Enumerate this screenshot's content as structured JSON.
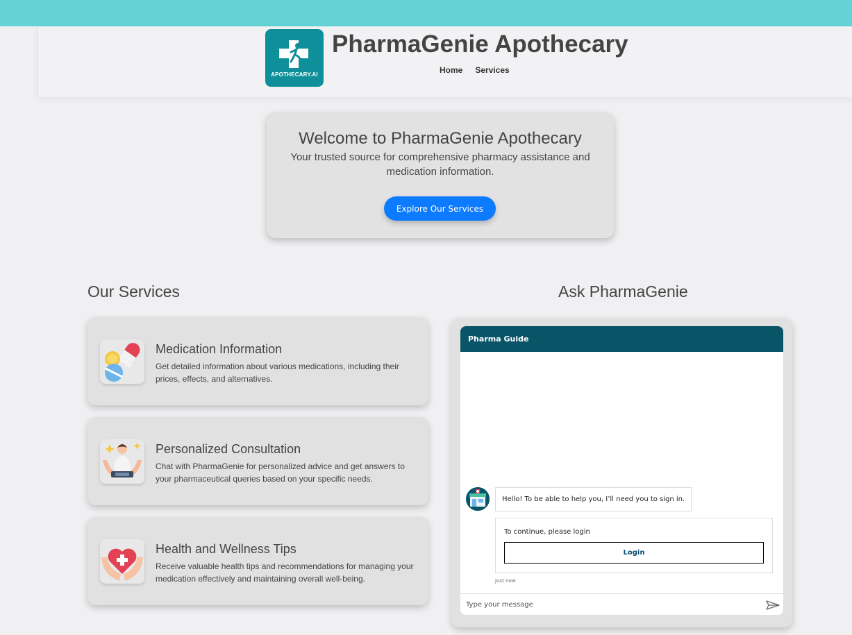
{
  "header": {
    "logo_text": "APOTHECARY.AI",
    "site_title": "PharmaGenie Apothecary",
    "nav": {
      "home": "Home",
      "services": "Services"
    }
  },
  "hero": {
    "title": "Welcome to PharmaGenie Apothecary",
    "subtitle": "Your trusted source for comprehensive pharmacy assistance and medication information.",
    "cta_label": "Explore Our Services"
  },
  "services": {
    "heading": "Our Services",
    "items": [
      {
        "icon": "pills-icon",
        "title": "Medication Information",
        "description": "Get detailed information about various medications, including their prices, effects, and alternatives."
      },
      {
        "icon": "pharmacist-icon",
        "title": "Personalized Consultation",
        "description": "Chat with PharmaGenie for personalized advice and get answers to your pharmaceutical queries based on your specific needs."
      },
      {
        "icon": "heart-hands-icon",
        "title": "Health and Wellness Tips",
        "description": "Receive valuable health tips and recommendations for managing your medication effectively and maintaining overall well-being."
      }
    ]
  },
  "chat": {
    "heading": "Ask PharmaGenie",
    "window_title": "Pharma Guide",
    "greeting": "Hello! To be able to help you, I’ll need you to sign in.",
    "login_prompt": "To continue, please login",
    "login_label": "Login",
    "timestamp": "Just now",
    "input_placeholder": "Type your message"
  },
  "colors": {
    "topbar": "#63d3d5",
    "logo_bg": "#0e8f99",
    "cta": "#0d7bff",
    "chat_header": "#0a5468"
  }
}
